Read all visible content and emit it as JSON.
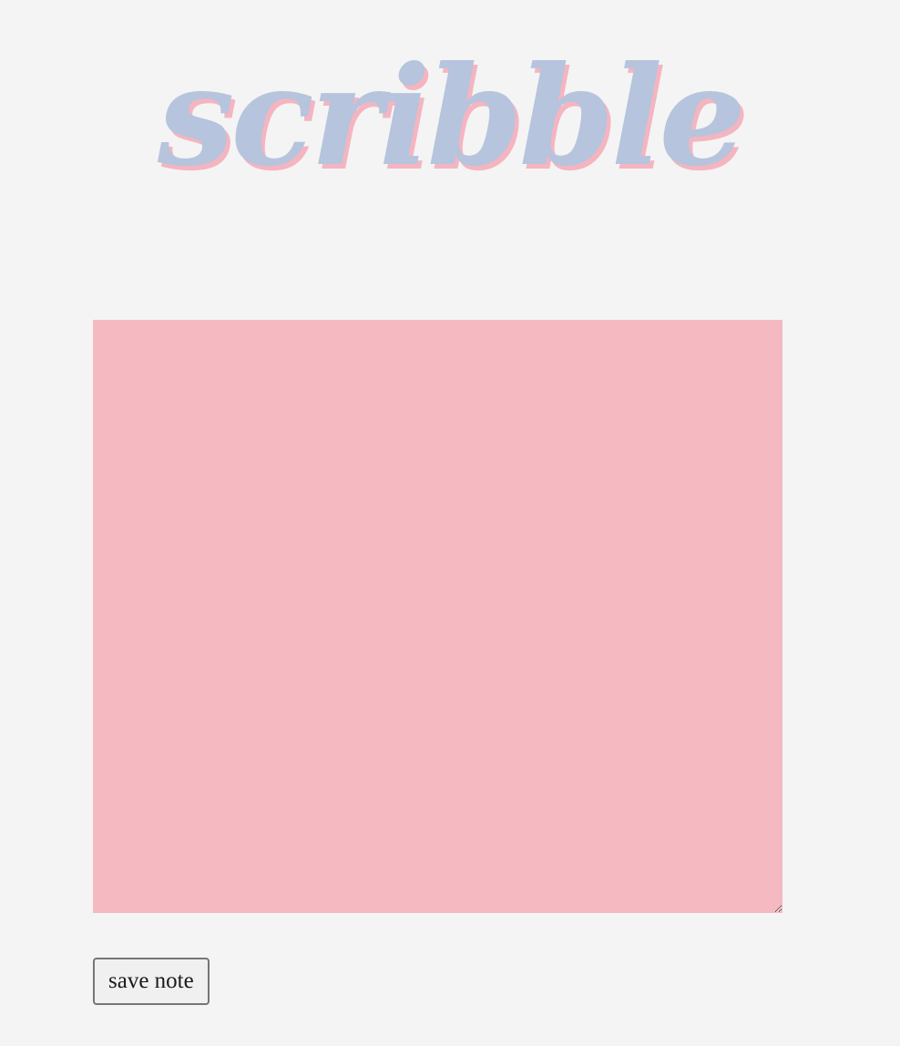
{
  "header": {
    "logo_text": "scribble"
  },
  "editor": {
    "value": "",
    "placeholder": ""
  },
  "actions": {
    "save_label": "save note"
  },
  "colors": {
    "background": "#f4f4f4",
    "logo_fill": "#b6c4dd",
    "logo_shadow": "#f4b5c0",
    "note_background": "#f4b9c1"
  }
}
